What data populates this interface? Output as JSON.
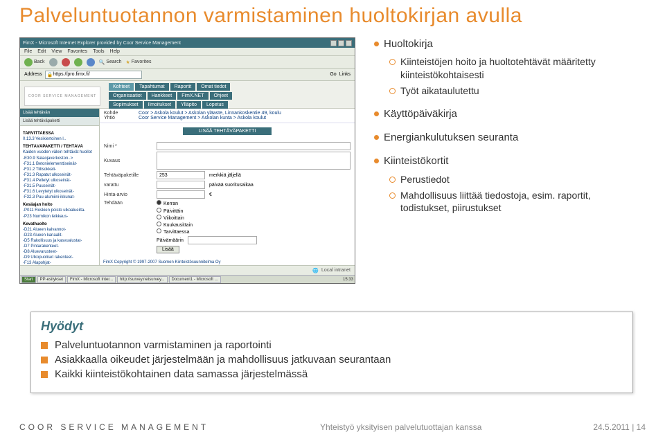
{
  "title": "Palveluntuotannon varmistaminen huoltokirjan avulla",
  "ie": {
    "windowTitle": "FimX - Microsoft Internet Explorer provided by Coor Service Management",
    "menu": [
      "File",
      "Edit",
      "View",
      "Favorites",
      "Tools",
      "Help"
    ],
    "toolbar": {
      "back": "Back",
      "search": "Search",
      "favorites": "Favorites"
    },
    "addressLabel": "Address",
    "addressValue": "https://pro.fimx.fi/",
    "go": "Go",
    "links": "Links",
    "statusRight": "Local intranet",
    "copyright": "FimX Copyright © 1997-2007 Suomen Kiinteistösuunnitelma Oy",
    "taskbar": {
      "start": "Start",
      "items": [
        "PP-esitykset",
        "FimX - Microsoft Inter...",
        "http://survey.netsurvey...",
        "Document1 - Microsoft ..."
      ],
      "clock": "15:33"
    }
  },
  "page": {
    "logo": "COOR SERVICE MANAGEMENT",
    "navRows": [
      [
        "Kohteet",
        "Tapahtumat",
        "Raportit",
        "Omat tiedot"
      ],
      [
        "Organisaatiot",
        "Hankkeet",
        "FimX.NET",
        "Ohjeet"
      ],
      [
        "Sopimukset",
        "Ilmoitukset",
        "Ylläpito",
        "Lopetus"
      ]
    ],
    "sidebarTabs": [
      "Lisää tehtävän",
      "Lisää tehtäväpaketti"
    ],
    "sidebar": {
      "head1": "TARVITTAESSA",
      "i1": "0.13.3 Vesikiertoinen l..",
      "head2": "TEHTÄVÄPAKETTI / TEHTÄVÄ",
      "i2": "Kaiden vuoden välein tehtävät huollot",
      "i3": "-E30.9 Salaojaverkoston..>",
      "i4": "-F31.1 Betonielementtiseinät-",
      "i5": "-F31.2 Tiilisokkeli-",
      "i6": "-F31.3 Rapatut ulkoseinät-",
      "i7": "-F31.4 Pelletyt ulkoseinät-",
      "i8": "-F31.5 Puuseinät-",
      "i9": "-F31.6 Levytetyt ulkoseinät-",
      "i10": "-F32.3 Puu-alumiini-ikkunat-",
      "head3": "Kesäajan hoito",
      "i11": "-P011 Roskien poisto ulkoalueilta-",
      "i12": "-P23 Nurmikon leikkaus-",
      "head4": "Kevathuolto",
      "i13": "-D21 Alueen kalvannot-",
      "i14": "-D23 Alueen kanaalit-",
      "i15": "-D5 Rakollisuus ja kasvualustat-",
      "i16": "-D7 Pintarakenteet-",
      "i17": "-D8 Aluevarusteet-",
      "i18": "-D9 Ulkopuoliset rakenteet-",
      "i19": "-F13 Alapohjat-"
    },
    "crumbs": {
      "kohdeLabel": "Kohde",
      "kohdeValue": "Coor > Askola koulut > Askolan yläaste, Linnankoskentie 49, koulu",
      "yhtioLabel": "Yhtiö",
      "yhtioValue": "Coor Service Management > Askolan kunta > Askola koulut"
    },
    "addButton": "LISÄÄ TEHTÄVÄPAKETTI",
    "form": {
      "nimi": "Nimi *",
      "kuvaus": "Kuvaus",
      "pakLabel": "Tehtäväpaketille",
      "pakVal": "253",
      "pakUnit": "merkkiä jäljellä",
      "varLabel": "varattu",
      "varUnit": "päivää suoritusaikaa",
      "hintaLabel": "Hinta-arvio",
      "hintaUnit": "€",
      "tehdaan": "Tehdään",
      "radios": [
        "Kerran",
        "Päivittäin",
        "Viikoittain",
        "Kuukausittain",
        "Tarvittaessa"
      ],
      "paivamaarin": "Päivämäärin",
      "lisaa": "Lisää"
    }
  },
  "bullets": {
    "g1_head": "Huoltokirja",
    "g1_s1": "Kiinteistöjen hoito ja huoltotehtävät määritetty kiinteistökohtaisesti",
    "g1_s2": "Työt aikataulutettu",
    "g2_head": "Käyttöpäiväkirja",
    "g3_head": "Energiankulutuksen seuranta",
    "g4_head": "Kiinteistökortit",
    "g4_s1": "Perustiedot",
    "g4_s2": "Mahdollisuus liittää tiedostoja, esim. raportit, todistukset, piirustukset"
  },
  "benefits": {
    "title": "Hyödyt",
    "items": [
      "Palveluntuotannon varmistaminen ja raportointi",
      "Asiakkaalla oikeudet järjestelmään ja mahdollisuus jatkuvaan seurantaan",
      "Kaikki kiinteistökohtainen data samassa järjestelmässä"
    ]
  },
  "footer": {
    "left": "COOR SERVICE MANAGEMENT",
    "center": "Yhteistyö yksityisen palvelutuottajan kanssa",
    "right": "24.5.2011   |  14"
  }
}
